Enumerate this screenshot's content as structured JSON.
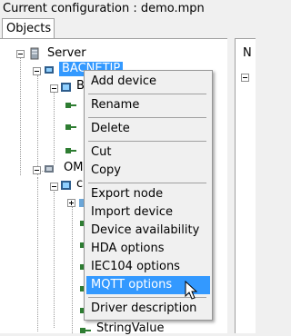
{
  "window": {
    "title": "Current configuration : demo.mpn"
  },
  "tabs": [
    {
      "label": "Objects"
    }
  ],
  "right_panel": {
    "header_letter": "N"
  },
  "tree": {
    "server": "Server",
    "bacnet": "BACNETIP",
    "bacnet_child": "B",
    "om": "OM",
    "om_child": "c",
    "string_value": "StringValue"
  },
  "context_menu": {
    "items": [
      "Add device",
      "Rename",
      "Delete",
      "Cut",
      "Copy",
      "Export node",
      "Import device",
      "Device availability",
      "HDA options",
      "IEC104 options",
      "MQTT options",
      "Driver description"
    ],
    "highlighted": "MQTT options"
  },
  "colors": {
    "selection": "#3399ff",
    "menu_bg": "#f0f0f0"
  }
}
